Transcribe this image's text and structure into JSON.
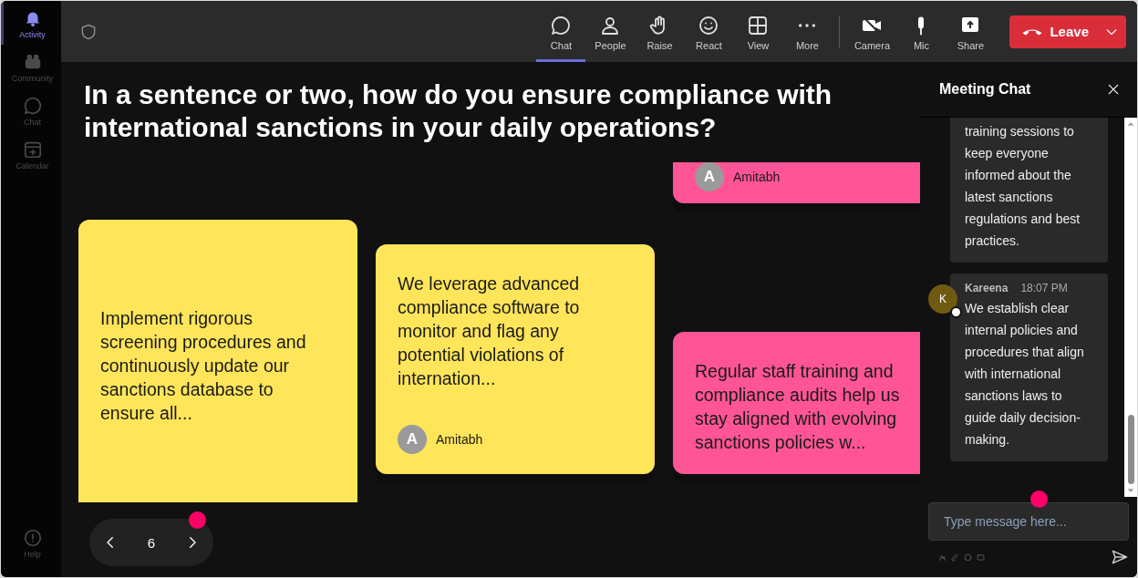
{
  "sidebar": {
    "items": [
      {
        "label": "Activity",
        "selected": true
      },
      {
        "label": "Community",
        "selected": false
      },
      {
        "label": "Chat",
        "selected": false
      },
      {
        "label": "Calendar",
        "selected": false
      }
    ],
    "help": "Help"
  },
  "toolbar": {
    "items": [
      {
        "label": "Chat",
        "kind": "chat",
        "selected": true
      },
      {
        "label": "People",
        "kind": "people",
        "selected": false
      },
      {
        "label": "Raise",
        "kind": "raise",
        "selected": false
      },
      {
        "label": "React",
        "kind": "react",
        "selected": false
      },
      {
        "label": "View",
        "kind": "view",
        "selected": false
      },
      {
        "label": "More",
        "kind": "more",
        "selected": false
      }
    ],
    "devices": [
      {
        "label": "Camera",
        "kind": "camera"
      },
      {
        "label": "Mic",
        "kind": "mic"
      },
      {
        "label": "Share",
        "kind": "share"
      }
    ],
    "leave_button": "Leave"
  },
  "question": "In a sentence or two, how do you ensure compliance with international sanctions in your daily operations?",
  "board": {
    "columns": [
      {
        "cards": [
          {
            "text": "Implement rigorous screening procedures and continuously update our sanctions database to ensure all...",
            "color": "#ffe55a"
          }
        ]
      },
      {
        "cards": [
          {
            "text": "We leverage advanced compliance software to monitor and flag any potential violations of internation...",
            "author": "Amitabh",
            "avatar": "A",
            "color": "#ffe55a"
          }
        ]
      },
      {
        "cards": [
          {
            "author": "Amitabh",
            "avatar": "A",
            "color": "#ff5596"
          },
          {
            "text": "Regular staff training and compliance audits help us stay aligned with evolving sanctions policies w...",
            "color": "#ff5596"
          }
        ]
      }
    ]
  },
  "pagination": {
    "page": "6"
  },
  "chat": {
    "title": "Meeting Chat",
    "messages": [
      {
        "text": "training sessions to keep everyone informed about the latest sanctions regulations and best practices."
      },
      {
        "author": "Kareena",
        "time": "18:07 PM",
        "avatar": "K",
        "text": "We establish clear internal policies and procedures that align with international sanctions laws to guide daily decision-making."
      }
    ],
    "input": {
      "placeholder": "Type message here..."
    }
  }
}
